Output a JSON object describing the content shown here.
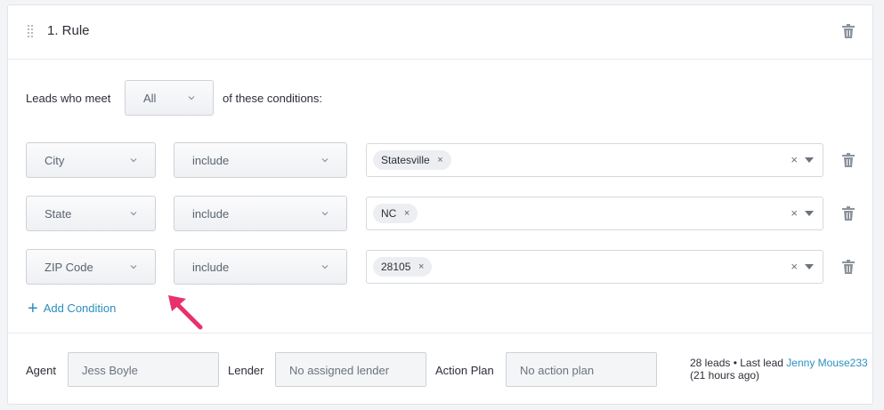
{
  "rule": {
    "title": "1. Rule"
  },
  "match": {
    "prefix": "Leads who meet",
    "mode": "All",
    "suffix": "of these conditions:"
  },
  "conditions": [
    {
      "field": "City",
      "operator": "include",
      "value": "Statesville"
    },
    {
      "field": "State",
      "operator": "include",
      "value": "NC"
    },
    {
      "field": "ZIP Code",
      "operator": "include",
      "value": "28105"
    }
  ],
  "glyphs": {
    "tag_remove": "×",
    "clear": "×"
  },
  "add_condition": {
    "plus": "+",
    "label": "Add Condition"
  },
  "footer": {
    "agent_label": "Agent",
    "agent_value": "Jess Boyle",
    "lender_label": "Lender",
    "lender_value": "No assigned lender",
    "action_plan_label": "Action Plan",
    "action_plan_value": "No action plan",
    "summary_text": "28 leads • Last lead",
    "last_lead_name": "Jenny Mouse233",
    "last_lead_time": "(21 hours ago)"
  },
  "icons": {
    "drag": "drag-handle-icon",
    "trash": "trash-icon",
    "chevron": "chevron-down-icon",
    "pointer": "annotation-arrow-icon"
  },
  "colors": {
    "link": "#2a8fbd",
    "annotation_arrow": "#e8316b"
  }
}
